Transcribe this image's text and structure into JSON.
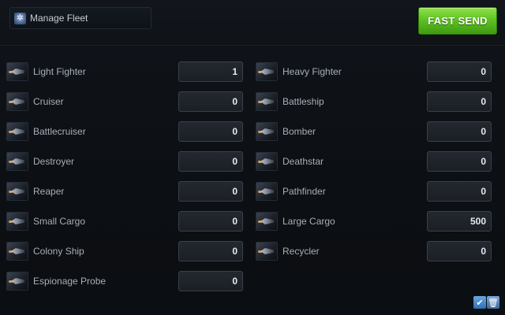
{
  "header": {
    "manage_label": "Manage Fleet",
    "manage_icon": "gear-icon",
    "fast_send_label": "FAST SEND",
    "fast_send_color": "#5fc224"
  },
  "ships": {
    "light_fighter": {
      "name": "Light Fighter",
      "qty": "1"
    },
    "heavy_fighter": {
      "name": "Heavy Fighter",
      "qty": "0"
    },
    "cruiser": {
      "name": "Cruiser",
      "qty": "0"
    },
    "battleship": {
      "name": "Battleship",
      "qty": "0"
    },
    "battlecruiser": {
      "name": "Battlecruiser",
      "qty": "0"
    },
    "bomber": {
      "name": "Bomber",
      "qty": "0"
    },
    "destroyer": {
      "name": "Destroyer",
      "qty": "0"
    },
    "deathstar": {
      "name": "Deathstar",
      "qty": "0"
    },
    "reaper": {
      "name": "Reaper",
      "qty": "0"
    },
    "pathfinder": {
      "name": "Pathfinder",
      "qty": "0"
    },
    "small_cargo": {
      "name": "Small Cargo",
      "qty": "0"
    },
    "large_cargo": {
      "name": "Large Cargo",
      "qty": "500"
    },
    "colony_ship": {
      "name": "Colony Ship",
      "qty": "0"
    },
    "recycler": {
      "name": "Recycler",
      "qty": "0"
    },
    "espionage_probe": {
      "name": "Espionage Probe",
      "qty": "0"
    }
  },
  "footer": {
    "check_icon": "checkmark-icon",
    "trash_icon": "trash-icon",
    "check_glyph": "✔",
    "trash_glyph": "🗑"
  }
}
